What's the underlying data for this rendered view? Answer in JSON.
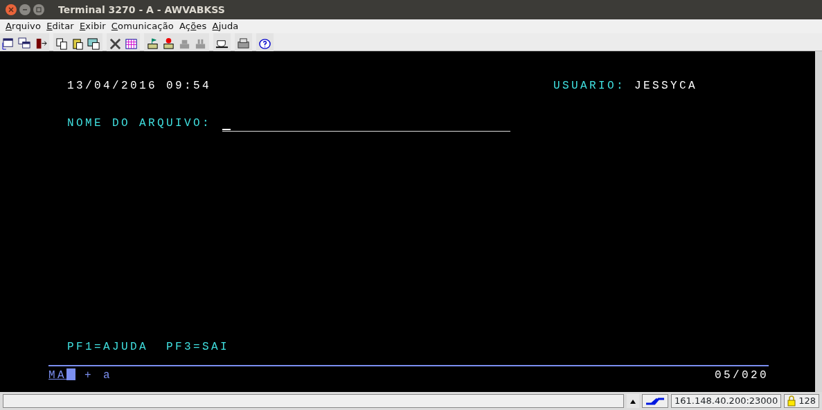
{
  "window": {
    "title": "Terminal 3270 - A - AWVABKSS"
  },
  "menu": [
    {
      "mnemonic": "A",
      "rest": "rquivo"
    },
    {
      "mnemonic": "E",
      "rest": "ditar"
    },
    {
      "mnemonic": "E",
      "rest": "xibir"
    },
    {
      "mnemonic": "C",
      "rest": "omunicação"
    },
    {
      "prefix": "Aç",
      "mnemonic": "õ",
      "rest": "es"
    },
    {
      "mnemonic": "A",
      "rest": "juda"
    }
  ],
  "screen": {
    "date_time": "13/04/2016 09:54",
    "user_label": "USUARIO:",
    "user": "JESSYCA",
    "field_label": "NOME DO ARQUIVO:",
    "function_keys": "PF1=AJUDA  PF3=SAI"
  },
  "operator_line": {
    "mode": "MA",
    "sign": "+",
    "input_mode": "a",
    "cursor_position": "05/020"
  },
  "status_bar": {
    "host": "161.148.40.200:23000",
    "key_size": "128"
  }
}
